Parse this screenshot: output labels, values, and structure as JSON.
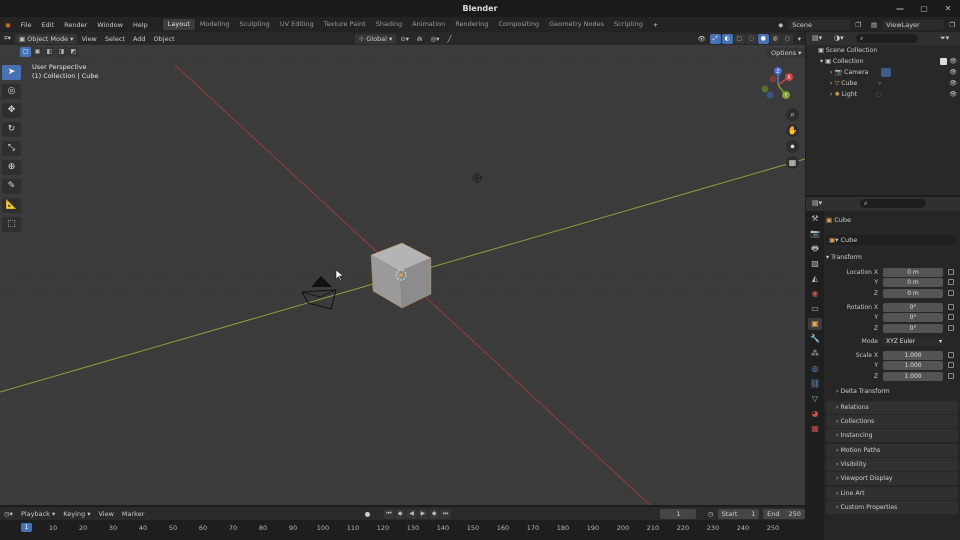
{
  "window": {
    "title": "Blender",
    "controls": [
      "—",
      "▢",
      "✕"
    ]
  },
  "menu": {
    "items": [
      "File",
      "Edit",
      "Render",
      "Window",
      "Help"
    ],
    "workspaces": [
      "Layout",
      "Modeling",
      "Sculpting",
      "UV Editing",
      "Texture Paint",
      "Shading",
      "Animation",
      "Rendering",
      "Compositing",
      "Geometry Nodes",
      "Scripting"
    ],
    "active_workspace": "Layout",
    "add_workspace": "+",
    "scene": "Scene",
    "view_layer": "ViewLayer"
  },
  "viewport": {
    "mode": "Object Mode",
    "menus": [
      "View",
      "Select",
      "Add",
      "Object"
    ],
    "transform_orientation": "Global",
    "options_label": "Options",
    "info_line1": "User Perspective",
    "info_line2": "(1) Collection | Cube",
    "gizmo_labels": {
      "x": "X",
      "y": "Y",
      "z": "Z"
    }
  },
  "outliner": {
    "root": "Scene Collection",
    "collection": "Collection",
    "objects": [
      "Camera",
      "Cube",
      "Light"
    ]
  },
  "properties": {
    "object_name": "Cube",
    "datablock": "Cube",
    "transform_header": "Transform",
    "location": {
      "label": "Location X",
      "x": "0 m",
      "y": "0 m",
      "z": "0 m"
    },
    "rotation": {
      "label": "Rotation X",
      "x": "0°",
      "y": "0°",
      "z": "0°"
    },
    "axis_y": "Y",
    "axis_z": "Z",
    "mode_label": "Mode",
    "rotation_mode": "XYZ Euler",
    "scale": {
      "label": "Scale X",
      "x": "1.000",
      "y": "1.000",
      "z": "1.000"
    },
    "delta_transform": "Delta Transform",
    "panels": [
      "Relations",
      "Collections",
      "Instancing",
      "Motion Paths",
      "Visibility",
      "Viewport Display",
      "Line Art",
      "Custom Properties"
    ]
  },
  "timeline": {
    "menus": [
      "Playback",
      "Keying",
      "View",
      "Marker"
    ],
    "current_frame": "1",
    "start_label": "Start",
    "start": "1",
    "end_label": "End",
    "end": "250",
    "ruler": [
      "1",
      "10",
      "20",
      "30",
      "40",
      "50",
      "60",
      "70",
      "80",
      "90",
      "100",
      "110",
      "120",
      "130",
      "140",
      "150",
      "160",
      "170",
      "180",
      "190",
      "200",
      "210",
      "220",
      "230",
      "240",
      "250"
    ]
  },
  "colors": {
    "accent": "#4772b3",
    "x_axis": "#9c3a3a",
    "y_axis": "#8aa03a",
    "background": "#3b3b3b"
  }
}
